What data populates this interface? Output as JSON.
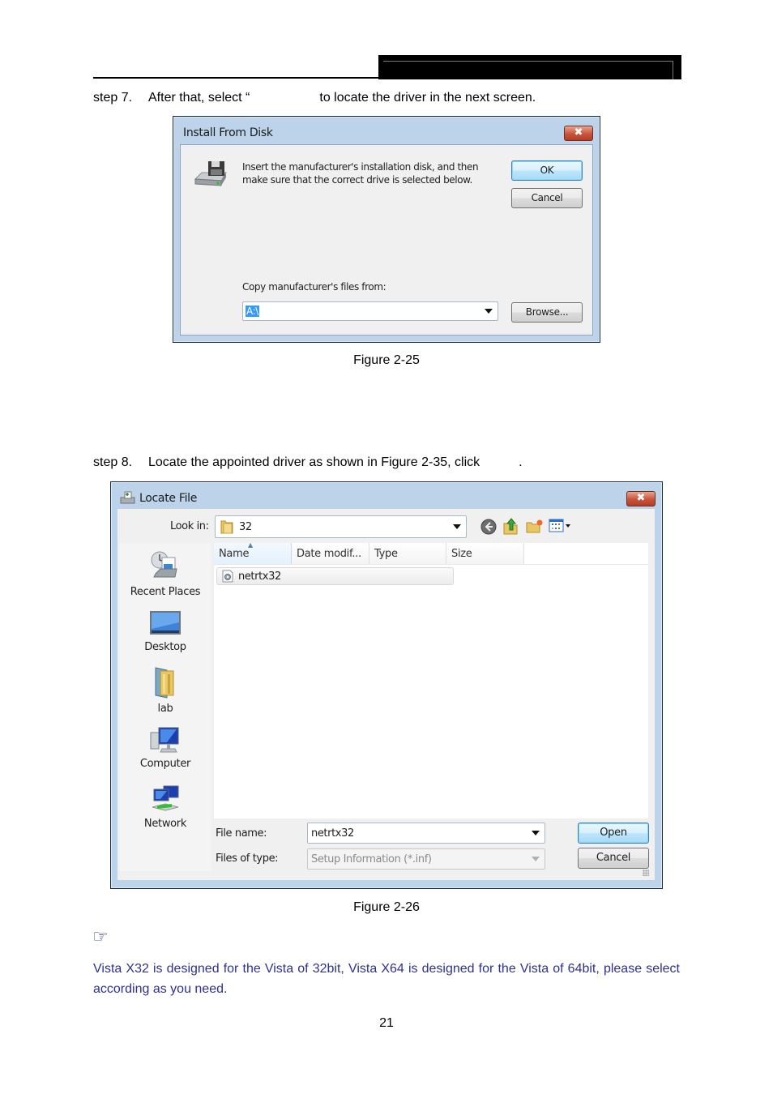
{
  "page": {
    "step7": {
      "num": "step 7.",
      "text_before": "After that, select “",
      "text_after": "to locate the driver in the next screen."
    },
    "figure1_caption": "Figure 2-25",
    "step8": {
      "num": "step 8.",
      "text_before": "Locate the appointed driver as shown in Figure 2-35, click",
      "text_after": "."
    },
    "figure2_caption": "Figure 2-26",
    "note_icon": "☞",
    "note_text": "Vista X32 is designed for the Vista of 32bit, Vista X64 is designed for the Vista of 64bit, please select according as you need.",
    "page_number": "21",
    "colors": {
      "note": "#2e3192",
      "header_bar": "#000000"
    }
  },
  "install_dialog": {
    "title": "Install From Disk",
    "close_glyph": "✖",
    "icon": "floppy-drive-icon",
    "message_line1": "Insert the manufacturer's installation disk, and then",
    "message_line2": "make sure that the correct drive is selected below.",
    "ok_label": "OK",
    "cancel_label": "Cancel",
    "copy_label": "Copy manufacturer's files from:",
    "copy_value": "A:\\",
    "browse_label": "Browse..."
  },
  "locate_dialog": {
    "title": "Locate File",
    "close_glyph": "✖",
    "look_in_label": "Look in:",
    "look_in_value": "32",
    "toolbar": [
      "back-icon",
      "up-folder-icon",
      "new-folder-icon",
      "views-menu-icon"
    ],
    "places": [
      {
        "label": "Recent Places",
        "icon": "recent-places-icon"
      },
      {
        "label": "Desktop",
        "icon": "desktop-icon"
      },
      {
        "label": "lab",
        "icon": "user-folder-icon"
      },
      {
        "label": "Computer",
        "icon": "computer-icon"
      },
      {
        "label": "Network",
        "icon": "network-icon"
      }
    ],
    "columns": [
      "Name",
      "Date modif...",
      "Type",
      "Size"
    ],
    "files": [
      {
        "name": "netrtx32",
        "icon": "setup-info-file-icon"
      }
    ],
    "file_name_label": "File name:",
    "file_name_value": "netrtx32",
    "file_type_label": "Files of type:",
    "file_type_value": "Setup Information (*.inf)",
    "open_label": "Open",
    "cancel_label": "Cancel"
  }
}
